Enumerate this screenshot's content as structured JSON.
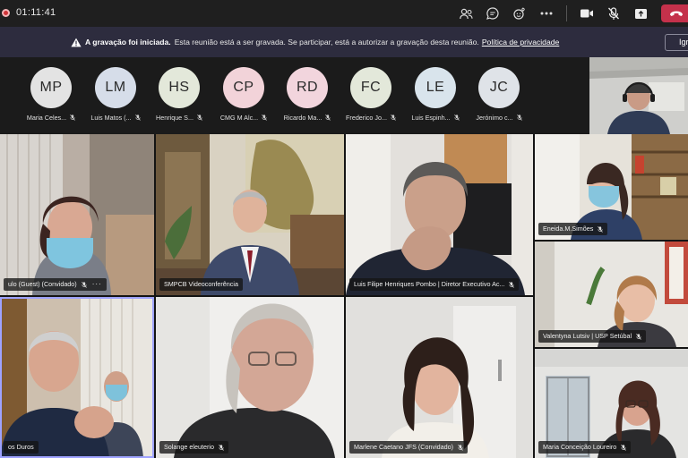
{
  "meeting": {
    "timer": "01:11:41"
  },
  "toolbar": {
    "buttons": [
      {
        "name": "people-button",
        "icon": "people-icon"
      },
      {
        "name": "chat-button",
        "icon": "chat-icon"
      },
      {
        "name": "reactions-button",
        "icon": "reactions-icon"
      },
      {
        "name": "more-actions-button",
        "icon": "more-icon"
      },
      {
        "name": "camera-button",
        "icon": "camera-icon"
      },
      {
        "name": "mic-button",
        "icon": "mic-off-icon"
      },
      {
        "name": "share-button",
        "icon": "share-icon"
      },
      {
        "name": "leave-button",
        "icon": "hang-up-icon"
      }
    ]
  },
  "banner": {
    "title": "A gravação foi iniciada.",
    "text": "Esta reunião está a ser gravada. Se participar, está a autorizar a gravação desta reunião.",
    "link": "Política de privacidade",
    "dismiss": "Igr"
  },
  "avatars": [
    {
      "initials": "MP",
      "name": "Maria Celes...",
      "color": "#e3e3e3"
    },
    {
      "initials": "LM",
      "name": "Luis Matos (...",
      "color": "#d6dde9"
    },
    {
      "initials": "HS",
      "name": "Henrique S...",
      "color": "#e3e8da"
    },
    {
      "initials": "CP",
      "name": "CMG M Alc...",
      "color": "#f2d3d9"
    },
    {
      "initials": "RD",
      "name": "Ricardo Ma...",
      "color": "#f2d5dd"
    },
    {
      "initials": "FC",
      "name": "Frederico Jo...",
      "color": "#e3e8da"
    },
    {
      "initials": "LE",
      "name": "Luis Espinh...",
      "color": "#d9e4ec"
    },
    {
      "initials": "JC",
      "name": "Jerónimo c...",
      "color": "#dfe3e8"
    }
  ],
  "tiles": [
    {
      "label": "ulo (Guest) (Convidado)",
      "has_more": true
    },
    {
      "label": "SMPCB Videoconferência"
    },
    {
      "label": "Luis Filipe Henriques Pombo | Diretor Executivo Ac..."
    },
    {
      "label": "Eneida.M.Simões"
    },
    {
      "label": "Valentyna Lutsiv | USP Setúbal"
    },
    {
      "label": "os Duros"
    },
    {
      "label": "Solange eleuterio"
    },
    {
      "label": "Marlene Caetano JFS (Convidado)"
    },
    {
      "label": "Maria Conceição Loureiro"
    }
  ],
  "colors": {
    "banner_bg": "#2d2c3e",
    "leave_red": "#c4314b",
    "active_speaker": "#9ea2ff"
  }
}
